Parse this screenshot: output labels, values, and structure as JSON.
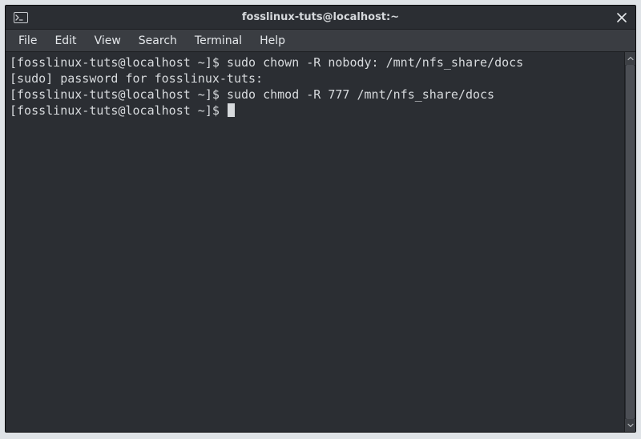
{
  "window": {
    "title": "fosslinux-tuts@localhost:~"
  },
  "menubar": {
    "items": [
      "File",
      "Edit",
      "View",
      "Search",
      "Terminal",
      "Help"
    ]
  },
  "colors": {
    "bg": "#2b2e33",
    "fg": "#d7dadd",
    "menubar_bg": "#3a3d42"
  },
  "terminal": {
    "prompt_prefix": "[fosslinux-tuts@localhost ~]$ ",
    "lines": [
      {
        "prompt": "[fosslinux-tuts@localhost ~]$ ",
        "cmd": "sudo chown -R nobody: /mnt/nfs_share/docs"
      },
      {
        "text": "[sudo] password for fosslinux-tuts:"
      },
      {
        "prompt": "[fosslinux-tuts@localhost ~]$ ",
        "cmd": "sudo chmod -R 777 /mnt/nfs_share/docs"
      },
      {
        "prompt": "[fosslinux-tuts@localhost ~]$ ",
        "cursor": true
      }
    ]
  }
}
